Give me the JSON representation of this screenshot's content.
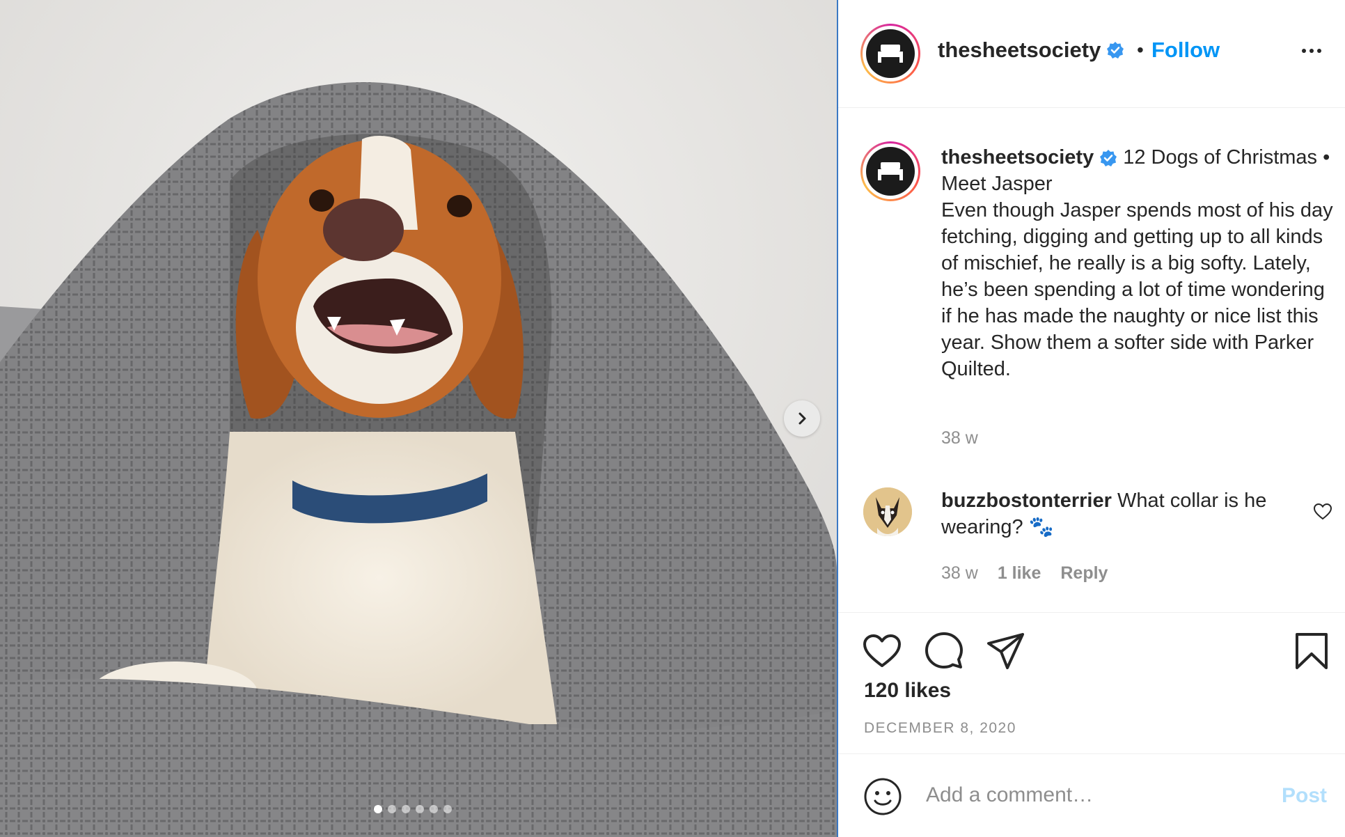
{
  "post": {
    "carousel": {
      "slide_count": 6,
      "active_index": 0
    }
  },
  "header": {
    "username": "thesheetsociety",
    "separator": "•",
    "follow_label": "Follow"
  },
  "caption": {
    "username": "thesheetsociety",
    "text": "12 Dogs of Christmas • Meet Jasper\nEven though Jasper spends most of his day fetching, digging and getting up to all kinds of mischief, he really is a big softy. Lately, he’s been spending a lot of time wondering if he has made the naughty or nice list this year. Show them a softer side with Parker Quilted.",
    "timestamp": "38 w"
  },
  "comment": {
    "username": "buzzbostonterrier",
    "text": "What collar is he wearing? 🐾",
    "timestamp": "38 w",
    "likes": "1 like",
    "reply_label": "Reply"
  },
  "actions": {
    "likes_label": "120 likes",
    "date": "DECEMBER 8, 2020"
  },
  "add_comment": {
    "placeholder": "Add a comment…",
    "post_label": "Post"
  },
  "colors": {
    "accent": "#0095f6",
    "post_disabled": "#b2dffc",
    "muted_text": "#8e8e8e",
    "verified": "#3897f0"
  },
  "icons": [
    "chevron-right-icon",
    "more-icon",
    "verified-icon",
    "heart-icon",
    "comment-icon",
    "share-icon",
    "bookmark-icon",
    "emoji-icon"
  ]
}
